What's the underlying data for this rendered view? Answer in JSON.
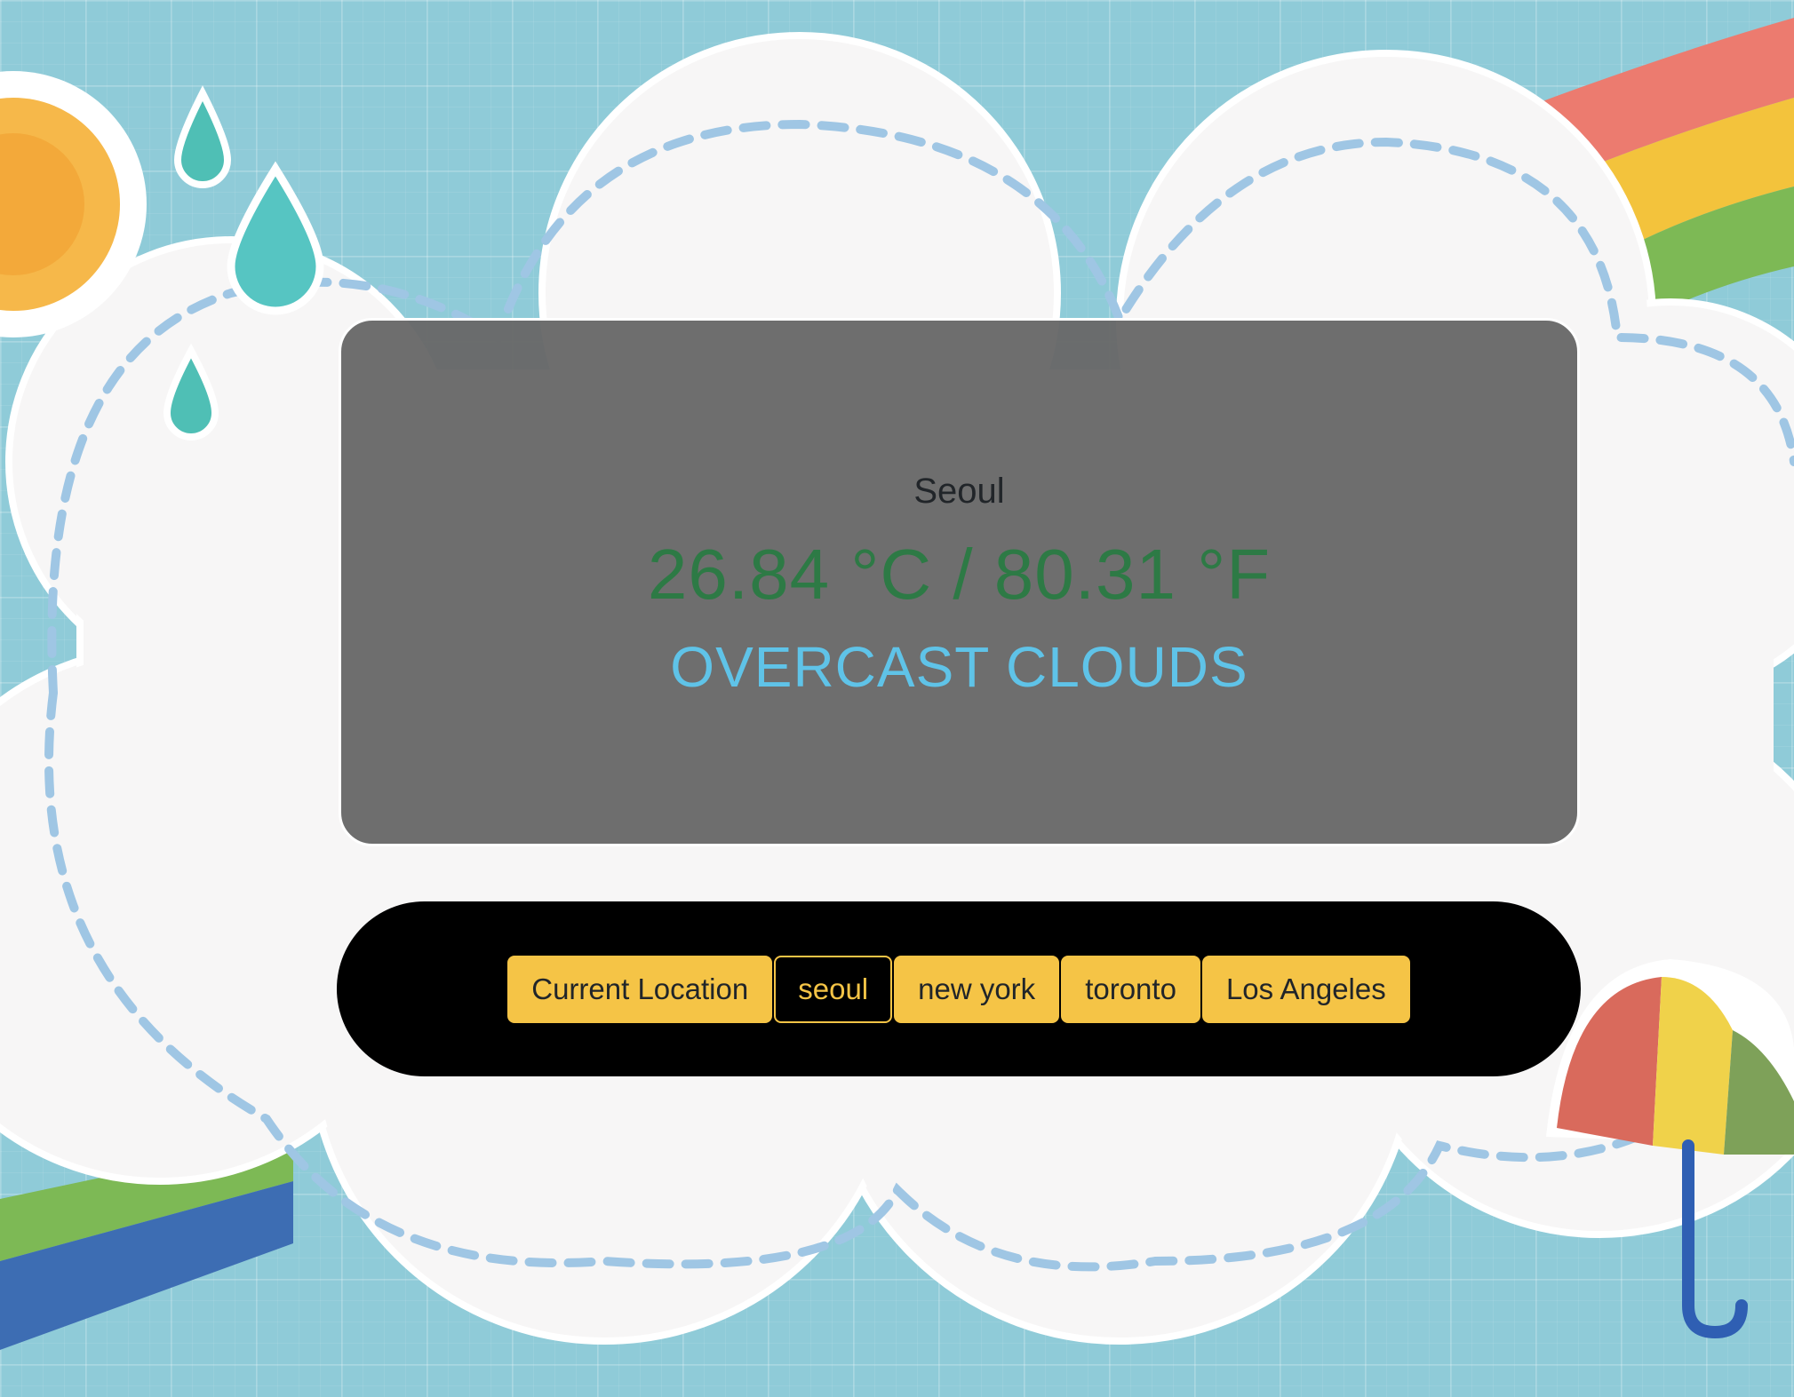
{
  "weather": {
    "city": "Seoul",
    "temperature": "26.84 °C / 80.31 °F",
    "description": "OVERCAST CLOUDS"
  },
  "city_buttons": [
    {
      "label": "Current Location",
      "active": false
    },
    {
      "label": "seoul",
      "active": true
    },
    {
      "label": "new york",
      "active": false
    },
    {
      "label": "toronto",
      "active": false
    },
    {
      "label": "Los Angeles",
      "active": false
    }
  ],
  "colors": {
    "accent_yellow": "#f5c446",
    "temperature_green": "#2d7a45",
    "description_blue": "#5fc3e8",
    "card_gray": "#686868",
    "background_blue": "#8fcbd8"
  }
}
